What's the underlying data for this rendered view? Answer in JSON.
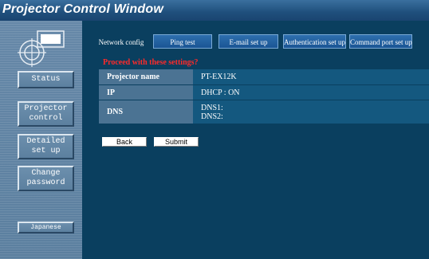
{
  "window": {
    "title": "Projector Control Window"
  },
  "sidebar": {
    "logo_icon": "projector-lens-icon",
    "buttons": [
      {
        "label": "Status"
      },
      {
        "label": "Projector\ncontrol"
      },
      {
        "label": "Detailed\nset up"
      },
      {
        "label": "Change\npassword"
      },
      {
        "label": "Japanese"
      }
    ]
  },
  "tabs": [
    {
      "label": "Network config",
      "active": true
    },
    {
      "label": "Ping test",
      "active": false
    },
    {
      "label": "E-mail set up",
      "active": false
    },
    {
      "label": "Authentication set up",
      "active": false
    },
    {
      "label": "Command port set up",
      "active": false
    }
  ],
  "confirm": {
    "message": "Proceed with these settings?"
  },
  "settings": [
    {
      "label": "Projector name",
      "value": "PT-EX12K"
    },
    {
      "label": "IP",
      "value": "DHCP : ON"
    },
    {
      "label": "DNS",
      "value_line1": "DNS1:",
      "value_line2": "DNS2:"
    }
  ],
  "actions": {
    "back_label": "Back",
    "submit_label": "Submit"
  },
  "colors": {
    "title_bar": "#1f4f7c",
    "sidebar": "#5b7f9f",
    "main_bg": "#0a3f5f",
    "tab": "#1a5594",
    "label_cell": "#4b7393",
    "value_cell": "#14587f",
    "warning_text": "#ff2a2a"
  }
}
